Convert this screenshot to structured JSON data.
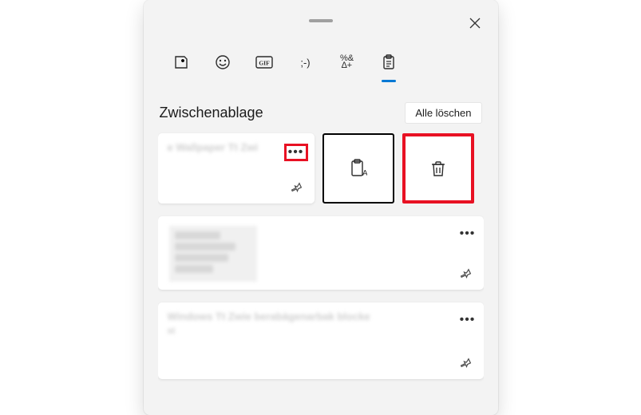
{
  "header": {
    "title": "Zwischenablage",
    "clear_all_label": "Alle löschen"
  },
  "tabs": [
    {
      "name": "sticker",
      "active": false
    },
    {
      "name": "emoji",
      "active": false
    },
    {
      "name": "gif",
      "active": false
    },
    {
      "name": "kaomoji",
      "active": false
    },
    {
      "name": "symbols",
      "active": false
    },
    {
      "name": "clipboard",
      "active": true
    }
  ],
  "items": [
    {
      "type": "text",
      "preview": "e Wallpaper Tt Zwi",
      "highlighted_more": true,
      "actions_expanded": true
    },
    {
      "type": "image",
      "preview": "",
      "highlighted_more": false,
      "actions_expanded": false
    },
    {
      "type": "text",
      "preview": "Windows Tt Zwie berabägenarbak blocke",
      "preview2": "st",
      "highlighted_more": false,
      "actions_expanded": false
    }
  ],
  "annotations": {
    "more_highlight_color": "#e81123",
    "delete_highlight_color": "#e81123"
  }
}
